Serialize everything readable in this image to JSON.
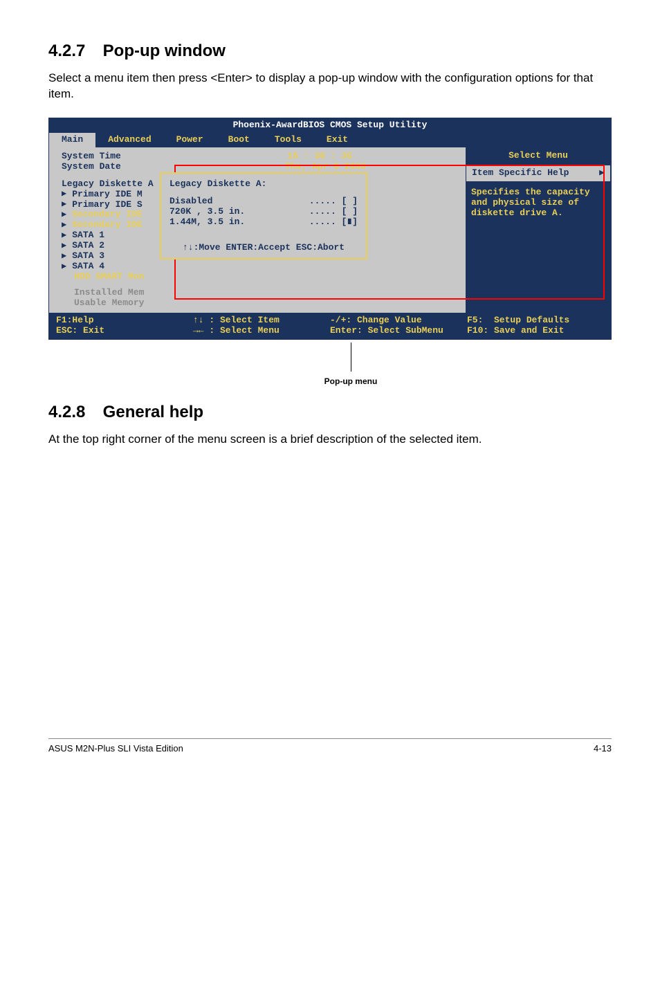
{
  "section1": {
    "num": "4.2.7",
    "title": "Pop-up window",
    "intro": "Select a menu item then press <Enter> to display a pop-up window with the configuration options for that item."
  },
  "bios": {
    "title": "Phoenix-AwardBIOS CMOS Setup Utility",
    "tabs": [
      "Main",
      "Advanced",
      "Power",
      "Boot",
      "Tools",
      "Exit"
    ],
    "system_time_label": "System Time",
    "system_time_value": "15 : 30 : 36",
    "system_date_label": "System Date",
    "system_date_value": "Thu, Apr 6  2006",
    "legacy_label": "Legacy Diskette A",
    "sub_items": [
      "Primary IDE M",
      "Primary IDE S",
      "Secondary IDE",
      "Secondary IDE",
      "SATA 1",
      "SATA 2",
      "SATA 3",
      "SATA 4",
      "HDD SMART Mon"
    ],
    "installed_mem": "Installed Mem",
    "usable_mem": "Usable Memory",
    "popup": {
      "title": "Legacy Diskette A:",
      "opts": [
        {
          "label": "Disabled",
          "mark": "..... [ ]"
        },
        {
          "label": "720K , 3.5 in.",
          "mark": "..... [ ]"
        },
        {
          "label": "1.44M, 3.5 in.",
          "mark": "..... [∎]"
        }
      ],
      "nav": "↑↓:Move  ENTER:Accept  ESC:Abort"
    },
    "side": {
      "menu_header": "Select Menu",
      "help_label": "Item Specific Help",
      "help_text": "Specifies the capacity and physical size of diskette drive A."
    },
    "footer": {
      "c1a": "F1:Help",
      "c1b": "ESC: Exit",
      "c2a": "↑↓ : Select Item",
      "c2b": "→← : Select Menu",
      "c3a": "-/+: Change Value",
      "c3b": "Enter: Select SubMenu",
      "c4a": "F5:  Setup Defaults",
      "c4b": "F10: Save and Exit"
    }
  },
  "callout": "Pop-up menu",
  "section2": {
    "num": "4.2.8",
    "title": "General help",
    "intro": "At the top right corner of the menu screen is a brief description of the selected item."
  },
  "footer": {
    "left": "ASUS M2N-Plus SLI Vista Edition",
    "right": "4-13"
  }
}
